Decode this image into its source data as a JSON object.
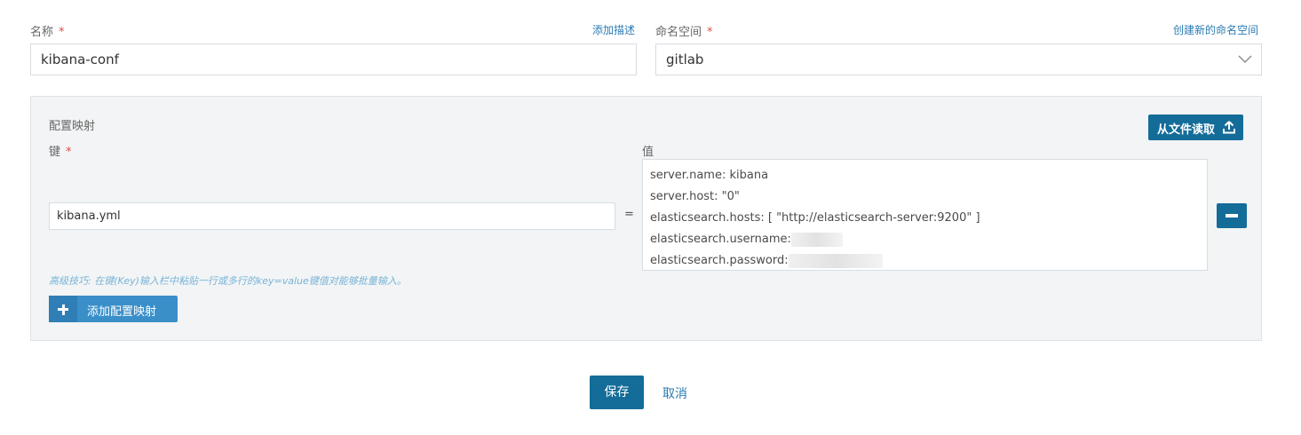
{
  "form": {
    "name_label": "名称",
    "required_mark": "*",
    "add_description_link": "添加描述",
    "name_value": "kibana-conf",
    "namespace_label": "命名空间",
    "create_namespace_link": "创建新的命名空间",
    "namespace_value": "gitlab"
  },
  "config_map": {
    "section_title": "配置映射",
    "read_from_file_label": "从文件读取",
    "key_label": "键",
    "value_label": "值",
    "equals": "=",
    "key_value": "kibana.yml",
    "value_lines": [
      "server.name: kibana",
      "server.host: \"0\"",
      "elasticsearch.hosts: [ \"http://elasticsearch-server:9200\" ]",
      "elasticsearch.username:",
      "elasticsearch.password:"
    ],
    "tip": "高级技巧: 在键(Key)输入栏中粘贴一行或多行的key=value键值对能够批量输入。",
    "add_mapping_label": "添加配置映射"
  },
  "actions": {
    "save_label": "保存",
    "cancel_label": "取消"
  },
  "colors": {
    "primary": "#146c99",
    "add_button": "#3a8fc9",
    "link": "#2a7bb3",
    "required": "#e24c4b"
  }
}
